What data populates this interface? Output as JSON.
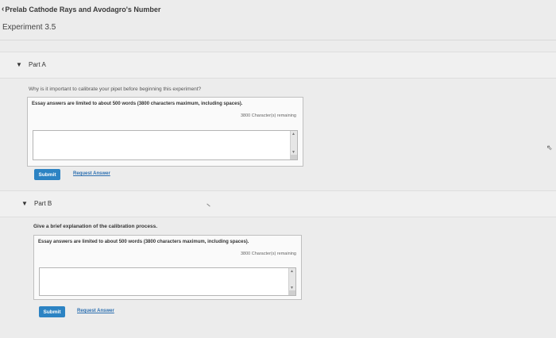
{
  "header": {
    "back_label": "Prelab Cathode Rays and Avodagro's Number",
    "experiment": "Experiment 3.5"
  },
  "partA": {
    "label": "Part A",
    "question": "Why is it important to calibrate your pipet before beginning this experiment?",
    "limit_text": "Essay answers are limited to about 500 words (3800 characters maximum, including spaces).",
    "remaining": "3800 Character(s) remaining",
    "answer_value": "",
    "submit_label": "Submit",
    "request_label": "Request Answer"
  },
  "partB": {
    "label": "Part B",
    "question": "Give a brief explanation of the calibration process.",
    "limit_text": "Essay answers are limited to about 500 words (3800 characters maximum, including spaces).",
    "remaining": "3800 Character(s) remaining",
    "answer_value": "",
    "submit_label": "Submit",
    "request_label": "Request Answer"
  },
  "colors": {
    "submit": "#2c83c3",
    "link": "#2c6fb0",
    "background": "#ececec"
  },
  "icons": {
    "back": "chevron-left-icon",
    "collapse": "triangle-down-icon",
    "cursor": "mouse-cursor-icon"
  }
}
